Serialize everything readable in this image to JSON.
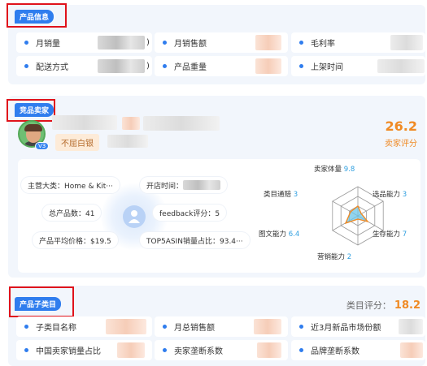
{
  "product_info": {
    "tag": "产品信息",
    "fields": [
      {
        "label": "月销量",
        "value_suffix": ")"
      },
      {
        "label": "月销售额"
      },
      {
        "label": "毛利率"
      },
      {
        "label": "配送方式",
        "value_suffix": ")"
      },
      {
        "label": "产品重量"
      },
      {
        "label": "上架时间"
      }
    ]
  },
  "seller": {
    "tag": "竞品卖家",
    "badge": "不屈白银",
    "level": "V3",
    "score": "26.2",
    "score_label": "卖家评分",
    "stats": {
      "main_category": "主营大类：Home & Kit···",
      "open_time": "开店时间：",
      "total_products": "总产品数：41",
      "feedback": "feedback评分：5",
      "avg_price": "产品平均价格：$19.5",
      "top5_share": "TOP5ASIN销量占比：93.4···"
    },
    "radar": {
      "axes": [
        {
          "name": "卖家体量",
          "value": "9.8"
        },
        {
          "name": "选品能力",
          "value": "3"
        },
        {
          "name": "生存能力",
          "value": "7"
        },
        {
          "name": "营销能力",
          "value": "2"
        },
        {
          "name": "图文能力",
          "value": "6.4"
        },
        {
          "name": "类目通赔",
          "value": "3"
        }
      ]
    }
  },
  "subcategory": {
    "tag": "产品子类目",
    "score_label": "类目评分：",
    "score": "18.2",
    "fields": [
      {
        "label": "子类目名称"
      },
      {
        "label": "月总销售额"
      },
      {
        "label": "近3月新品市场份额"
      },
      {
        "label": "中国卖家销量占比"
      },
      {
        "label": "卖家垄断系数"
      },
      {
        "label": "品牌垄断系数"
      }
    ]
  },
  "colors": {
    "accent": "#2f7dee",
    "orange": "#f08a24",
    "highlight": "#e0121b"
  }
}
